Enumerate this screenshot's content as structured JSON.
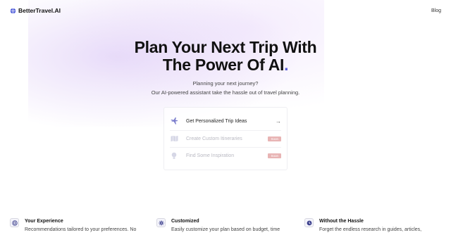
{
  "nav": {
    "brand": "BetterTravel.AI",
    "blog": "Blog"
  },
  "hero": {
    "title_line1": "Plan Your Next Trip With",
    "title_line2": "The Power Of AI",
    "title_dot": ".",
    "subtitle1": "Planning your next journey?",
    "subtitle2": "Our AI-powered assistant take the hassle out of travel planning."
  },
  "options": [
    {
      "label": "Get Personalized Trip Ideas",
      "icon": "plane-icon",
      "action": "→"
    },
    {
      "label": "Create Custom Itineraries",
      "icon": "map-icon",
      "badge": "Soon"
    },
    {
      "label": "Find Some Inspiration",
      "icon": "lightbulb-icon",
      "badge": "Soon"
    }
  ],
  "features": [
    {
      "title": "Your Experience",
      "desc": "Recommendations tailored to your preferences. No",
      "icon": "target-icon"
    },
    {
      "title": "Customized",
      "desc": "Easily customize your plan based on budget, time",
      "icon": "gear-icon"
    },
    {
      "title": "Without the Hassle",
      "desc": "Forget the endless research in guides, articles,",
      "icon": "clock-icon"
    }
  ],
  "colors": {
    "accent": "#5b5fd6",
    "badge": "#e8b4b4"
  }
}
